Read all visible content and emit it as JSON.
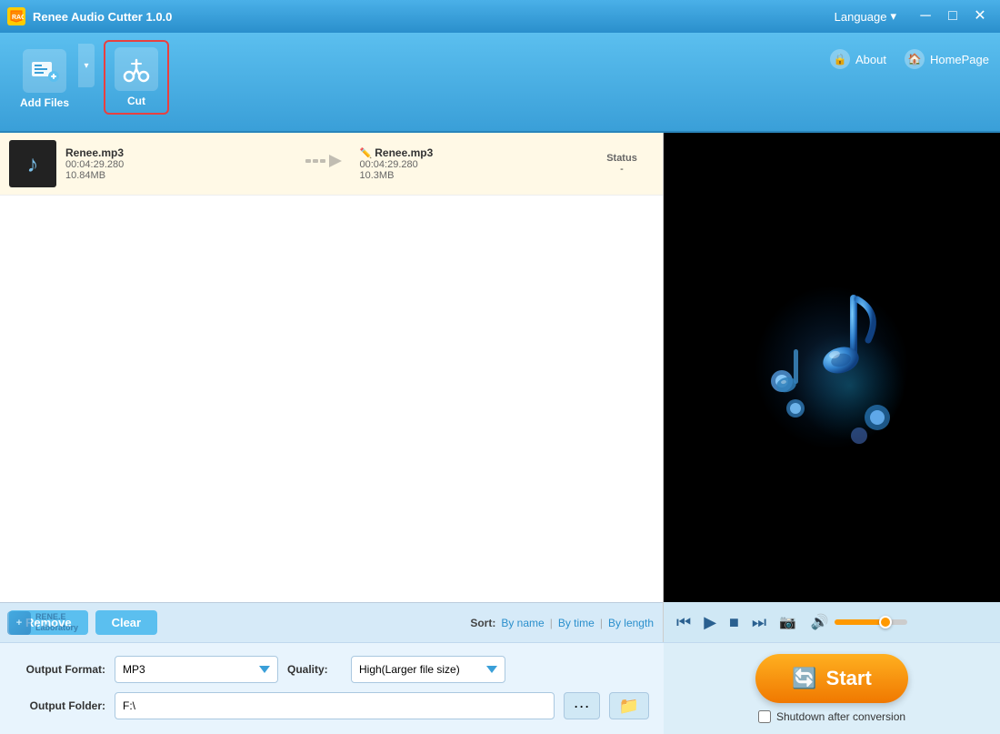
{
  "app": {
    "title": "Renee Audio Cutter 1.0.0",
    "logo_text": "R"
  },
  "titlebar": {
    "language_btn": "Language",
    "minimize_btn": "─",
    "maximize_btn": "□",
    "close_btn": "✕"
  },
  "toolbar": {
    "add_files_label": "Add Files",
    "cut_label": "Cut",
    "about_label": "About",
    "homepage_label": "HomePage"
  },
  "file_list": {
    "columns": [
      "",
      "",
      "",
      "",
      "Status"
    ],
    "items": [
      {
        "filename": "Renee.mp3",
        "duration": "00:04:29.280",
        "size": "10.84MB",
        "output_filename": "Renee.mp3",
        "output_duration": "00:04:29.280",
        "output_size": "10.3MB",
        "status_label": "Status",
        "status_value": "-"
      }
    ]
  },
  "buttons": {
    "remove": "Remove",
    "clear": "Clear"
  },
  "sort": {
    "label": "Sort:",
    "by_name": "By name",
    "by_time": "By time",
    "by_length": "By length"
  },
  "settings": {
    "output_format_label": "Output Format:",
    "output_format_value": "MP3",
    "quality_label": "Quality:",
    "quality_value": "High(Larger file size)",
    "output_folder_label": "Output Folder:",
    "output_folder_value": "F:\\"
  },
  "start_btn": "Start",
  "shutdown_label": "Shutdown after conversion",
  "renee_logo": "RENE.E\nLaboratory"
}
